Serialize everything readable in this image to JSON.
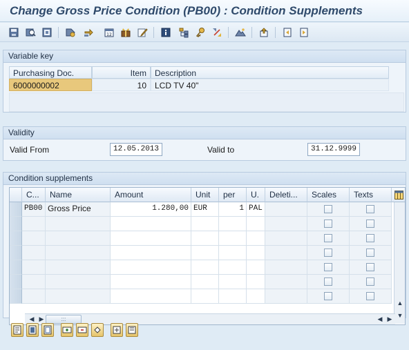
{
  "window": {
    "title": "Change Gross Price Condition (PB00) : Condition Supplements"
  },
  "toolbar": {
    "icons": [
      "save-icon",
      "find-icon",
      "local-file-icon",
      "display-icon",
      "go-to-icon",
      "calendar-icon",
      "gift-icon",
      "edit-icon",
      "info-icon",
      "structure-icon",
      "key-icon",
      "cross-reference-icon",
      "mountain-icon",
      "export-icon",
      "previous-page-icon",
      "next-page-icon"
    ]
  },
  "variable_key": {
    "group_title": "Variable key",
    "columns": [
      "Purchasing Doc.",
      "Item",
      "Description"
    ],
    "row": {
      "purchasing_doc": "6000000002",
      "item": "10",
      "description": "LCD TV 40\""
    }
  },
  "validity": {
    "group_title": "Validity",
    "valid_from_label": "Valid From",
    "valid_from": "12.05.2013",
    "valid_to_label": "Valid to",
    "valid_to": "31.12.9999"
  },
  "conditions": {
    "group_title": "Condition supplements",
    "columns": [
      "C...",
      "Name",
      "Amount",
      "Unit",
      "per",
      "U.",
      "Deleti...",
      "Scales",
      "Texts"
    ],
    "rows": [
      {
        "type": "PB00",
        "name": "Gross Price",
        "amount": "1.280,00",
        "unit": "EUR",
        "per": "1",
        "uom": "PAL"
      }
    ],
    "empty_rows": 6
  },
  "bottom_toolbar": {
    "icons": [
      "details-icon",
      "select-all-icon",
      "deselect-all-icon",
      "insert-row-icon",
      "delete-row-icon",
      "undo-icon",
      "add-line-icon",
      "remove-line-icon"
    ]
  }
}
